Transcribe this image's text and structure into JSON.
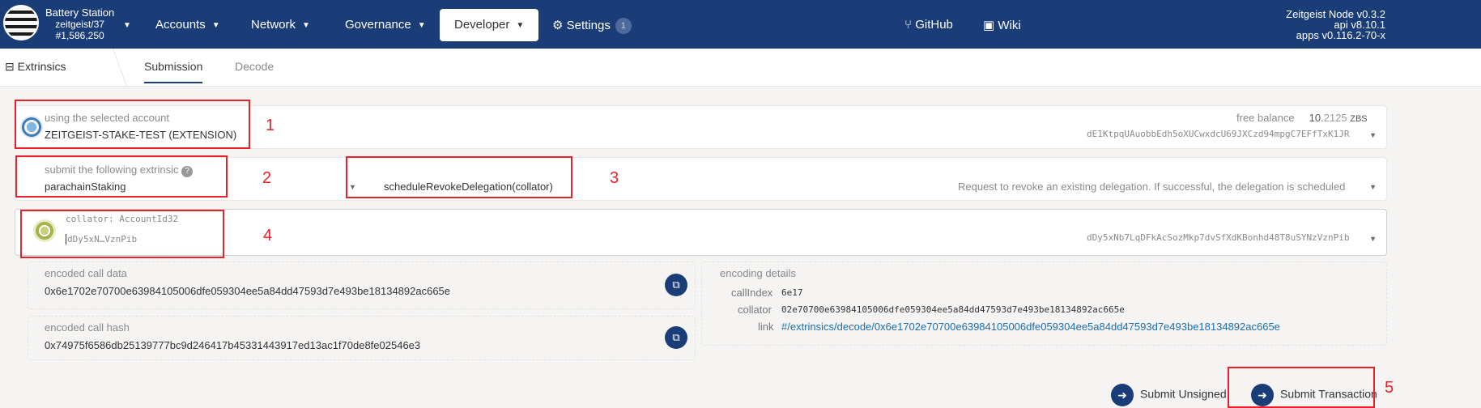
{
  "header": {
    "chain_name": "Battery Station",
    "chain_sub": "zeitgeist/37",
    "block": "#1,586,250",
    "menus": [
      "Accounts",
      "Network",
      "Governance",
      "Developer"
    ],
    "settings_label": "Settings",
    "settings_badge": "1",
    "github": "GitHub",
    "wiki": "Wiki",
    "version_lines": [
      "Zeitgeist Node v0.3.2",
      "api v8.10.1",
      "apps v0.116.2-70-x"
    ]
  },
  "subnav": {
    "section": "Extrinsics",
    "tabs": [
      "Submission",
      "Decode"
    ]
  },
  "account": {
    "label": "using the selected account",
    "name": "ZEITGEIST-STAKE-TEST (EXTENSION)",
    "balance_label": "free balance",
    "balance_int": "10.",
    "balance_dec": "2125",
    "balance_unit": "ZBS",
    "address": "dE1KtpqUAuobbEdh5oXUCwxdcU69JXCzd94mpgC7EFfTxK1JR"
  },
  "extrinsic": {
    "label": "submit the following extrinsic",
    "pallet": "parachainStaking",
    "method": "scheduleRevokeDelegation(collator)",
    "description": "Request to revoke an existing delegation. If successful, the delegation is scheduled"
  },
  "collator": {
    "label": "collator: AccountId32",
    "value": "dDy5xN…VznPib",
    "address": "dDy5xNb7LqDFkAcSozMkp7dvSfXdKBonhd48T8uSYNzVznPib"
  },
  "encoded": {
    "call_data_label": "encoded call data",
    "call_data": "0x6e1702e70700e63984105006dfe059304ee5a84dd47593d7e493be18134892ac665e",
    "call_hash_label": "encoded call hash",
    "call_hash": "0x74975f6586db25139777bc9d246417b45331443917ed13ac1f70de8fe02546e3"
  },
  "details": {
    "title": "encoding details",
    "call_index_label": "callIndex",
    "call_index": "6e17",
    "collator_label": "collator",
    "collator": "02e70700e63984105006dfe059304ee5a84dd47593d7e493be18134892ac665e",
    "link_label": "link",
    "link": "#/extrinsics/decode/0x6e1702e70700e63984105006dfe059304ee5a84dd47593d7e493be18134892ac665e"
  },
  "actions": {
    "unsigned": "Submit Unsigned",
    "transaction": "Submit Transaction"
  },
  "annotations": [
    "1",
    "2",
    "3",
    "4",
    "5"
  ],
  "colors": {
    "nav": "#1a3d78",
    "annotation": "#e8202a",
    "link": "#1a6fb0"
  }
}
